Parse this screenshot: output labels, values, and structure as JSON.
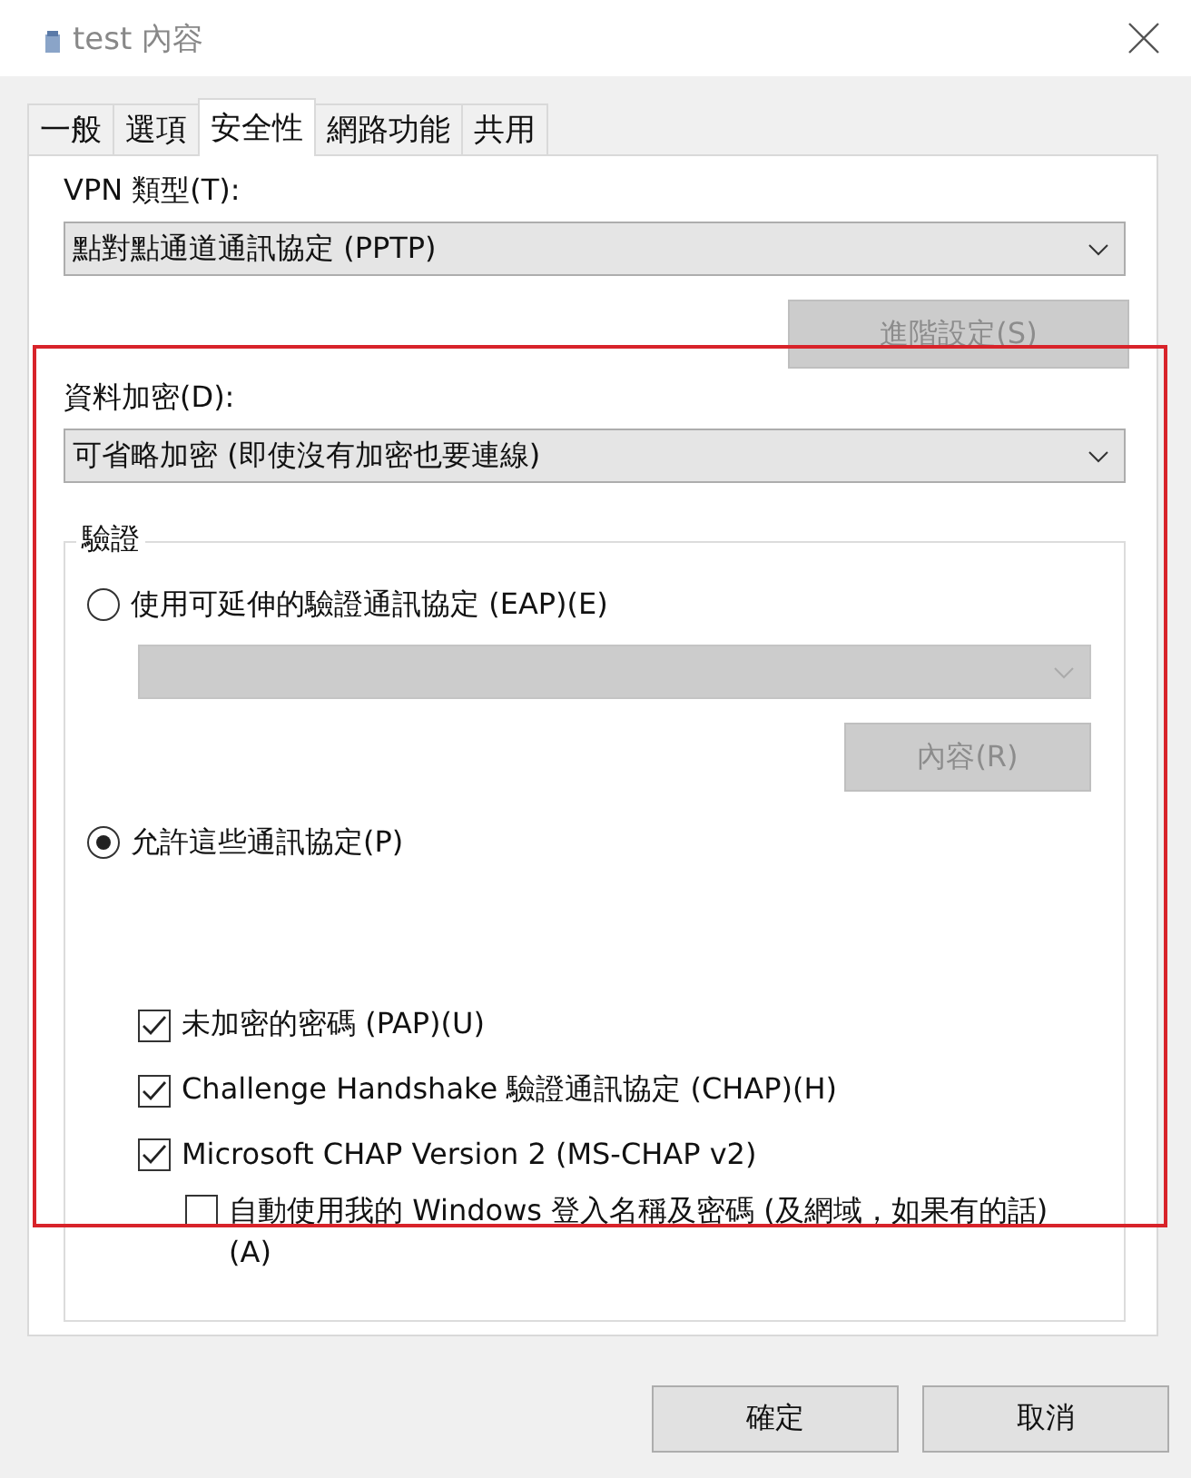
{
  "window": {
    "title": "test 內容"
  },
  "tabs": [
    {
      "label": "一般",
      "selected": false
    },
    {
      "label": "選項",
      "selected": false
    },
    {
      "label": "安全性",
      "selected": true
    },
    {
      "label": "網路功能",
      "selected": false
    },
    {
      "label": "共用",
      "selected": false
    }
  ],
  "vpn_type": {
    "label": "VPN 類型(T):",
    "value": "點對點通道通訊協定 (PPTP)"
  },
  "advanced_button": {
    "label": "進階設定(S)",
    "disabled": true
  },
  "encryption": {
    "label": "資料加密(D):",
    "value": "可省略加密 (即使沒有加密也要連線)"
  },
  "authentication": {
    "title": "驗證",
    "eap_option": {
      "label": "使用可延伸的驗證通訊協定 (EAP)(E)",
      "selected": false
    },
    "eap_dropdown": {
      "disabled": true
    },
    "properties_button": {
      "label": "內容(R)",
      "disabled": true
    },
    "protocols_option": {
      "label": "允許這些通訊協定(P)",
      "selected": true
    },
    "protocols": [
      {
        "label": "未加密的密碼 (PAP)(U)",
        "checked": true
      },
      {
        "label": "Challenge Handshake 驗證通訊協定 (CHAP)(H)",
        "checked": true
      },
      {
        "label": "Microsoft CHAP Version 2 (MS-CHAP v2)",
        "checked": true
      }
    ],
    "auto_login": {
      "label": "自動使用我的 Windows 登入名稱及密碼 (及網域，如果有的話)(A)",
      "checked": false
    }
  },
  "buttons": [
    "確定",
    "取消"
  ]
}
